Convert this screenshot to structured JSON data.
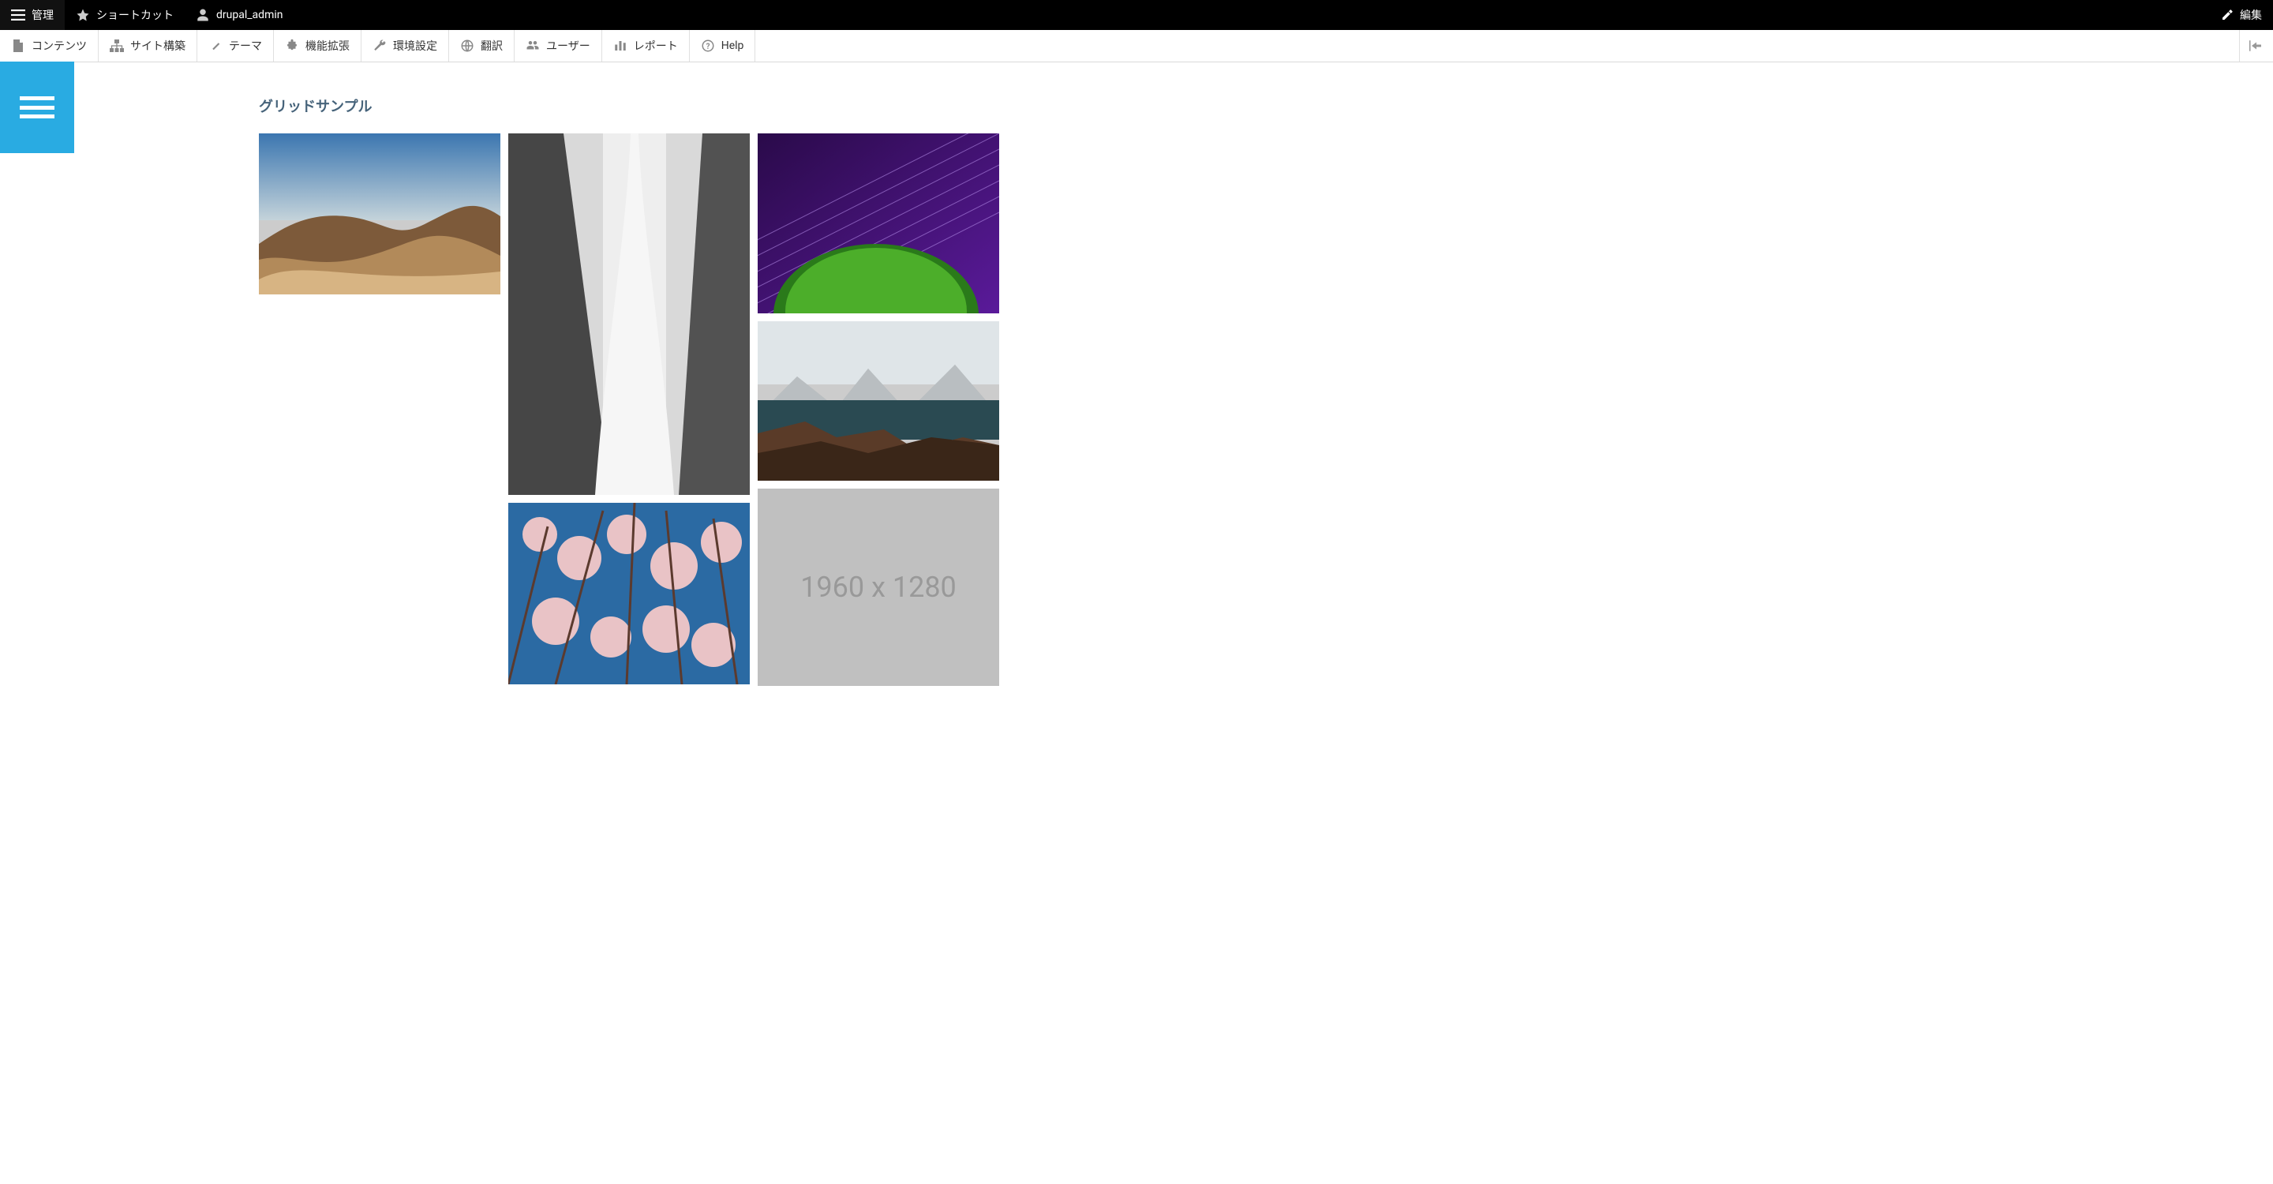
{
  "topbar": {
    "manage_label": "管理",
    "shortcut_label": "ショートカット",
    "user_label": "drupal_admin",
    "edit_label": "編集"
  },
  "secondbar": {
    "content_label": "コンテンツ",
    "structure_label": "サイト構築",
    "theme_label": "テーマ",
    "extension_label": "機能拡張",
    "settings_label": "環境設定",
    "translate_label": "翻訳",
    "user_label": "ユーザー",
    "report_label": "レポート",
    "help_label": "Help"
  },
  "page": {
    "title": "グリッドサンプル"
  },
  "grid": {
    "placeholder_label": "1960 x 1280",
    "images": [
      {
        "name": "desert"
      },
      {
        "name": "snow"
      },
      {
        "name": "purple"
      },
      {
        "name": "lake"
      },
      {
        "name": "blossom"
      },
      {
        "name": "placeholder"
      }
    ]
  }
}
